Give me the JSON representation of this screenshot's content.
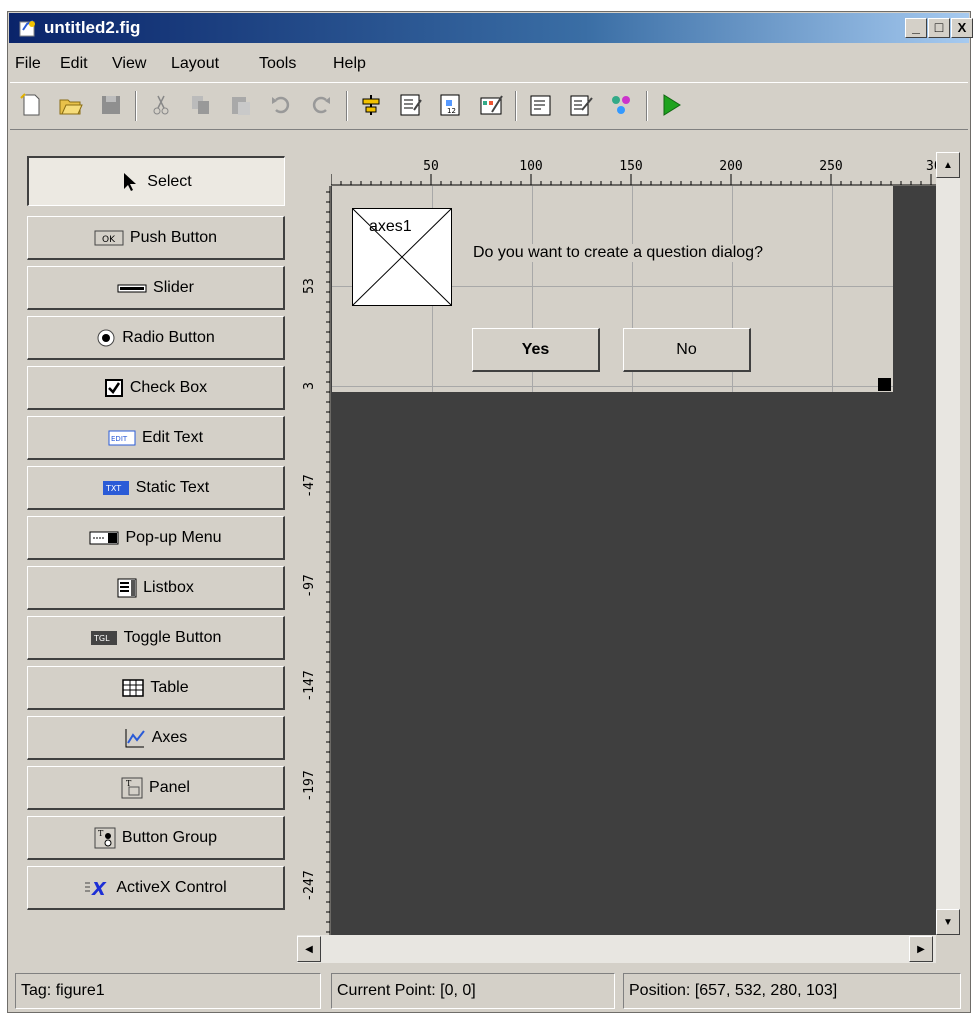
{
  "window": {
    "title": "untitled2.fig",
    "minimize": "_",
    "maximize": "□",
    "close": "X"
  },
  "menu": [
    "File",
    "Edit",
    "View",
    "Layout",
    "Tools",
    "Help"
  ],
  "toolbar": {
    "buttons": [
      "new-file-icon",
      "open-folder-icon",
      "save-icon",
      "cut-icon",
      "copy-icon",
      "paste-icon",
      "undo-icon",
      "redo-icon",
      "align-objects-icon",
      "menu-editor-icon",
      "tab-order-editor-icon",
      "toolbar-editor-icon",
      "m-file-editor-icon",
      "property-inspector-icon",
      "object-browser-icon",
      "run-figure-icon"
    ]
  },
  "palette": {
    "items": [
      {
        "label": "Select",
        "icon": "arrow-icon"
      },
      {
        "label": "Push Button",
        "icon": "push-button-icon"
      },
      {
        "label": "Slider",
        "icon": "slider-icon"
      },
      {
        "label": "Radio Button",
        "icon": "radio-button-icon"
      },
      {
        "label": "Check Box",
        "icon": "check-box-icon"
      },
      {
        "label": "Edit Text",
        "icon": "edit-text-icon"
      },
      {
        "label": "Static Text",
        "icon": "static-text-icon"
      },
      {
        "label": "Pop-up Menu",
        "icon": "popup-menu-icon"
      },
      {
        "label": "Listbox",
        "icon": "listbox-icon"
      },
      {
        "label": "Toggle Button",
        "icon": "toggle-button-icon"
      },
      {
        "label": "Table",
        "icon": "table-icon"
      },
      {
        "label": "Axes",
        "icon": "axes-icon"
      },
      {
        "label": "Panel",
        "icon": "panel-icon"
      },
      {
        "label": "Button Group",
        "icon": "button-group-icon"
      },
      {
        "label": "ActiveX Control",
        "icon": "activex-icon"
      }
    ]
  },
  "icon_text": {
    "push": "OK",
    "edit": "EDIT",
    "static": "TXT",
    "toggle": "TGL",
    "activex": "X"
  },
  "ruler": {
    "top_ticks": [
      "50",
      "100",
      "150",
      "200",
      "250",
      "30"
    ],
    "left_ticks": [
      "53",
      "3",
      "-47",
      "-97",
      "-147",
      "-197",
      "-247"
    ]
  },
  "figure": {
    "axes_label": "axes1",
    "question_text": "Do you want to create a question dialog?",
    "yes_label": "Yes",
    "no_label": "No"
  },
  "status": {
    "tag": "Tag: figure1",
    "current_point": "Current Point: [0, 0]",
    "position": "Position: [657, 532, 280, 103]"
  },
  "colors": {
    "titlebar_start": "#0a246a",
    "titlebar_end": "#a6caf0",
    "canvas_bg": "#3f3f3f",
    "window_bg": "#d4d0c8",
    "run_green": "#1ea31e"
  }
}
